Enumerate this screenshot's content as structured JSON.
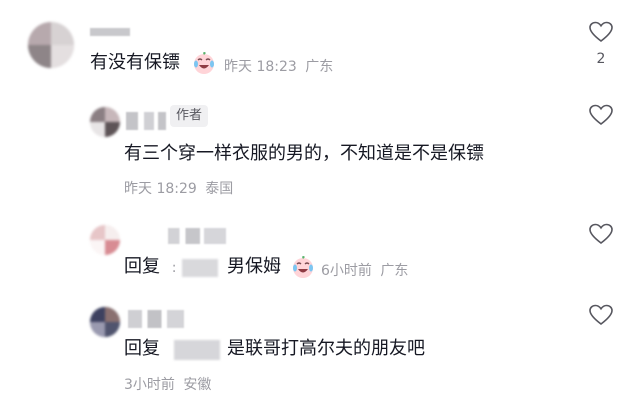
{
  "comments": [
    {
      "text": "有没有保镖",
      "time": "昨天 18:23",
      "location": "广东",
      "likes": "2"
    },
    {
      "author_tag": "作者",
      "text": "有三个穿一样衣服的男的，不知道是不是保镖",
      "time": "昨天 18:29",
      "location": "泰国"
    },
    {
      "reply_prefix": "回复",
      "reply_separator": ":",
      "text": "男保姆",
      "time": "6小时前",
      "location": "广东"
    },
    {
      "reply_prefix": "回复",
      "text": "是联哥打高尔夫的朋友吧",
      "time": "3小时前",
      "location": "安徽"
    }
  ],
  "icons": {
    "like": "heart-outline-icon",
    "emoji": "crying-laughing-emoji"
  },
  "colors": {
    "text": "#161823",
    "meta": "#9c9ca3",
    "tag_bg": "#f0f0f2"
  }
}
